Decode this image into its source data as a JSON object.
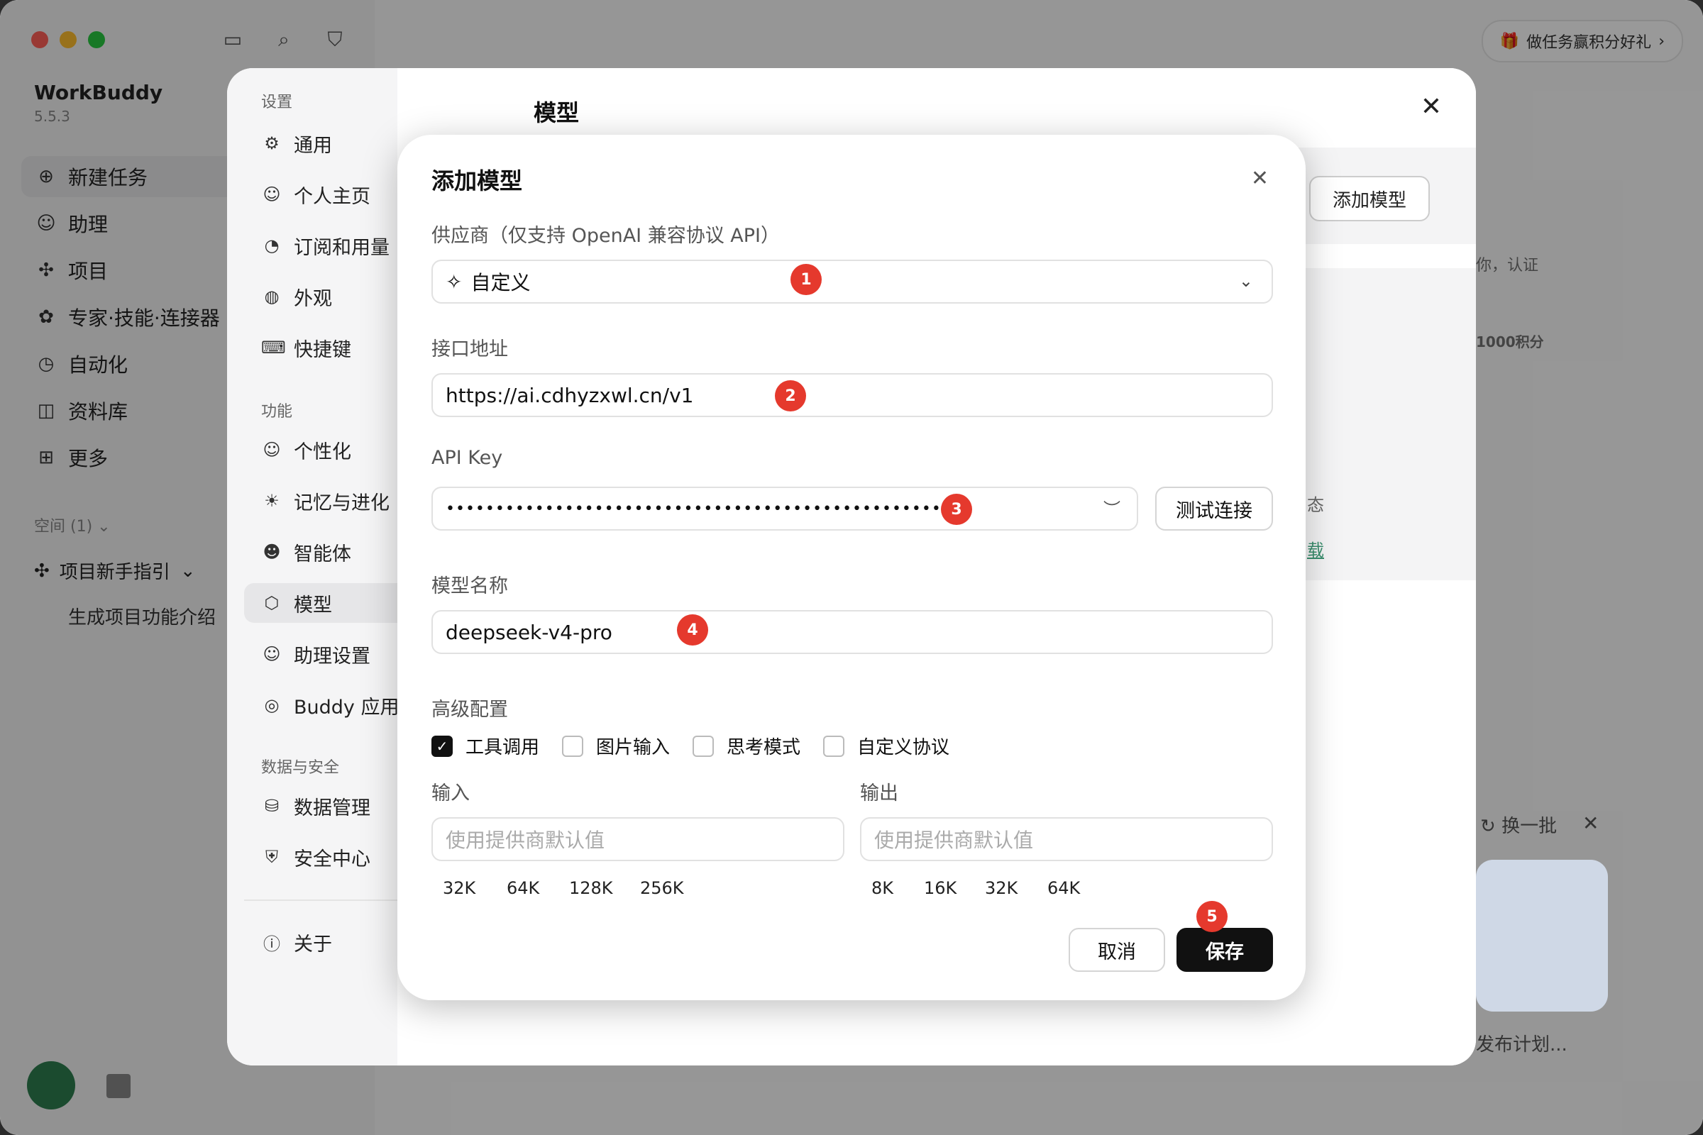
{
  "app": {
    "name": "WorkBuddy",
    "version": "5.5.3"
  },
  "sidebar": {
    "items": [
      {
        "label": "新建任务",
        "icon": "plus-circle-icon"
      },
      {
        "label": "助理",
        "icon": "assistant-icon"
      },
      {
        "label": "项目",
        "icon": "project-icon"
      },
      {
        "label": "专家·技能·连接器",
        "icon": "expert-icon"
      },
      {
        "label": "自动化",
        "icon": "alarm-icon"
      },
      {
        "label": "资料库",
        "icon": "book-icon"
      },
      {
        "label": "更多",
        "icon": "grid-icon"
      }
    ],
    "space_label": "空间 (1)",
    "project_label": "项目新手指引",
    "project_sub": "生成项目功能介绍"
  },
  "topbar": {
    "reward_label": "做任务赢积分好礼"
  },
  "settings": {
    "section_label": "设置",
    "title": "模型",
    "add_model_label": "添加模型",
    "groups": [
      {
        "label": "",
        "items": [
          {
            "label": "通用",
            "icon": "gear-icon"
          },
          {
            "label": "个人主页",
            "icon": "user-icon"
          },
          {
            "label": "订阅和用量",
            "icon": "chart-icon"
          },
          {
            "label": "外观",
            "icon": "palette-icon"
          },
          {
            "label": "快捷键",
            "icon": "keyboard-icon"
          }
        ]
      },
      {
        "label": "功能",
        "items": [
          {
            "label": "个性化",
            "icon": "user-gear-icon"
          },
          {
            "label": "记忆与进化",
            "icon": "bulb-icon"
          },
          {
            "label": "智能体",
            "icon": "robot-icon"
          },
          {
            "label": "模型",
            "icon": "cube-icon"
          },
          {
            "label": "助理设置",
            "icon": "assistant-icon"
          },
          {
            "label": "Buddy 应用",
            "icon": "app-icon"
          }
        ]
      },
      {
        "label": "数据与安全",
        "items": [
          {
            "label": "数据管理",
            "icon": "database-icon"
          },
          {
            "label": "安全中心",
            "icon": "shield-icon"
          }
        ]
      }
    ],
    "about_label": "关于",
    "bg_fragments": [
      "你，认证",
      "1000积分",
      "态",
      "载",
      "换一批",
      "发布计划..."
    ]
  },
  "dialog": {
    "title": "添加模型",
    "provider_label": "供应商（仅支持 OpenAI 兼容协议 API）",
    "provider_value": "自定义",
    "endpoint_label": "接口地址",
    "endpoint_value": "https://ai.cdhyzxwl.cn/v1",
    "apikey_label": "API Key",
    "apikey_value": "••••••••••••••••••••••••••••••••••••••••••••••••••",
    "test_button": "测试连接",
    "model_name_label": "模型名称",
    "model_name_value": "deepseek-v4-pro",
    "advanced_label": "高级配置",
    "checkboxes": [
      {
        "label": "工具调用",
        "checked": true
      },
      {
        "label": "图片输入",
        "checked": false
      },
      {
        "label": "思考模式",
        "checked": false
      },
      {
        "label": "自定义协议",
        "checked": false
      }
    ],
    "input_label": "输入",
    "output_label": "输出",
    "input_placeholder": "使用提供商默认值",
    "output_placeholder": "使用提供商默认值",
    "input_presets": [
      "32K",
      "64K",
      "128K",
      "256K"
    ],
    "output_presets": [
      "8K",
      "16K",
      "32K",
      "64K"
    ],
    "cancel_button": "取消",
    "save_button": "保存",
    "step_badges": [
      "1",
      "2",
      "3",
      "4",
      "5"
    ]
  },
  "colors": {
    "badge": "#e5392d",
    "primary": "#111111",
    "overlay": "rgba(0,0,0,0.40)"
  }
}
